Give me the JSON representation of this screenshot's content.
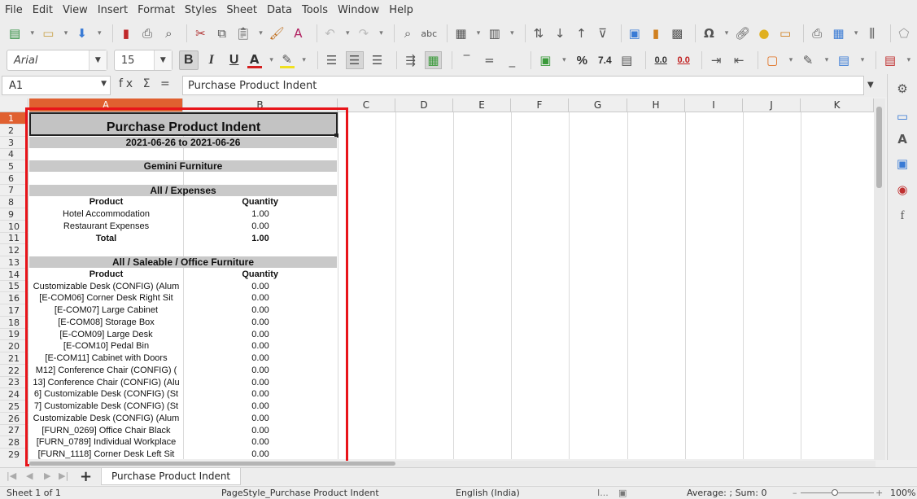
{
  "menu": [
    "File",
    "Edit",
    "View",
    "Insert",
    "Format",
    "Styles",
    "Sheet",
    "Data",
    "Tools",
    "Window",
    "Help"
  ],
  "toolbar": {
    "font_name": "Arial",
    "font_size": "15",
    "bold_label": "B",
    "italic_label": "I",
    "underline_label": "U",
    "percent_label": "%",
    "number_format_label": "7.4",
    "add_decimal_label": "0.0",
    "remove_decimal_label": "0.0"
  },
  "formula_bar": {
    "cell_ref": "A1",
    "fx_icons": "fx Σ =",
    "content": "Purchase Product Indent"
  },
  "columns": [
    "A",
    "B",
    "C",
    "D",
    "E",
    "F",
    "G",
    "H",
    "I",
    "J",
    "K"
  ],
  "rows": [
    "1",
    "2",
    "3",
    "4",
    "5",
    "6",
    "7",
    "8",
    "9",
    "10",
    "11",
    "12",
    "13",
    "14",
    "15",
    "16",
    "17",
    "18",
    "19",
    "20",
    "21",
    "22",
    "23",
    "24",
    "25",
    "26",
    "27",
    "28",
    "29"
  ],
  "sheet": {
    "title": "Purchase Product Indent",
    "date_range": "2021-06-26 to 2021-06-26",
    "company": "Gemini Furniture",
    "section1": {
      "title": "All / Expenses",
      "col_product": "Product",
      "col_quantity": "Quantity",
      "rows": [
        {
          "product": "Hotel Accommodation",
          "qty": "1.00"
        },
        {
          "product": "Restaurant Expenses",
          "qty": "0.00"
        }
      ],
      "total_label": "Total",
      "total_qty": "1.00"
    },
    "section2": {
      "title": "All / Saleable / Office Furniture",
      "col_product": "Product",
      "col_quantity": "Quantity",
      "rows": [
        {
          "product": "Customizable Desk (CONFIG) (Alum",
          "qty": "0.00"
        },
        {
          "product": "[E-COM06] Corner Desk Right Sit",
          "qty": "0.00"
        },
        {
          "product": "[E-COM07] Large Cabinet",
          "qty": "0.00"
        },
        {
          "product": "[E-COM08] Storage Box",
          "qty": "0.00"
        },
        {
          "product": "[E-COM09] Large Desk",
          "qty": "0.00"
        },
        {
          "product": "[E-COM10] Pedal Bin",
          "qty": "0.00"
        },
        {
          "product": "[E-COM11] Cabinet with Doors",
          "qty": "0.00"
        },
        {
          "product": "M12] Conference Chair (CONFIG) (",
          "qty": "0.00"
        },
        {
          "product": "13] Conference Chair (CONFIG) (Alu",
          "qty": "0.00"
        },
        {
          "product": "6] Customizable Desk (CONFIG) (St",
          "qty": "0.00"
        },
        {
          "product": "7] Customizable Desk (CONFIG) (St",
          "qty": "0.00"
        },
        {
          "product": "Customizable Desk (CONFIG) (Alum",
          "qty": "0.00"
        },
        {
          "product": "[FURN_0269] Office Chair Black",
          "qty": "0.00"
        },
        {
          "product": "[FURN_0789] Individual Workplace",
          "qty": "0.00"
        },
        {
          "product": "[FURN_1118] Corner Desk Left Sit",
          "qty": "0.00"
        }
      ]
    }
  },
  "tabs": {
    "sheet_name": "Purchase Product Indent",
    "add_label": "+"
  },
  "status": {
    "sheet_info": "Sheet 1 of 1",
    "page_style": "PageStyle_Purchase Product Indent",
    "language": "English (India)",
    "selection_mode": "I...",
    "sum_info": "Average: ; Sum: 0",
    "zoom_minus": "–",
    "zoom_plus": "+",
    "zoom_level": "100%"
  },
  "colors": {
    "accent": "#e06030",
    "highlight_box": "#e8141a",
    "band_gray": "#c9c9c9"
  }
}
